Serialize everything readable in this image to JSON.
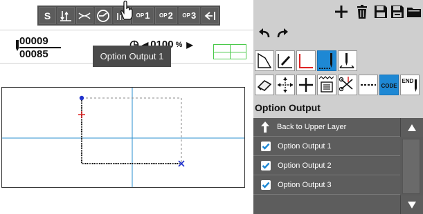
{
  "toolbar": {
    "s_label": "S",
    "op1_small": "OP",
    "op1_num": "1",
    "op2_small": "OP",
    "op2_num": "2",
    "op3_small": "OP",
    "op3_num": "3"
  },
  "counter": {
    "current": "00009",
    "total": "00085"
  },
  "speed": {
    "value": "0100",
    "unit": "%"
  },
  "tooltip": {
    "text": "Option Output 1"
  },
  "panel": {
    "title": "Option Output",
    "code_label": "CODE",
    "end_label": "END"
  },
  "list": {
    "items": [
      {
        "label": "Back to Upper Layer",
        "icon": "up-arrow-icon",
        "checked": null
      },
      {
        "label": "Option Output 1",
        "icon": "checkbox",
        "checked": true
      },
      {
        "label": "Option Output 2",
        "icon": "checkbox",
        "checked": true
      },
      {
        "label": "Option Output 3",
        "icon": "checkbox",
        "checked": true
      }
    ]
  },
  "colors": {
    "toolbar_bg": "#505050",
    "accent_blue": "#1e88d4",
    "list_bg": "#5d5d5d",
    "right_panel_bg": "#cfcfcf",
    "pattern_line": "#1a1a1a",
    "guide_line": "#2a8fcf",
    "mini_grid": "#49c949"
  }
}
